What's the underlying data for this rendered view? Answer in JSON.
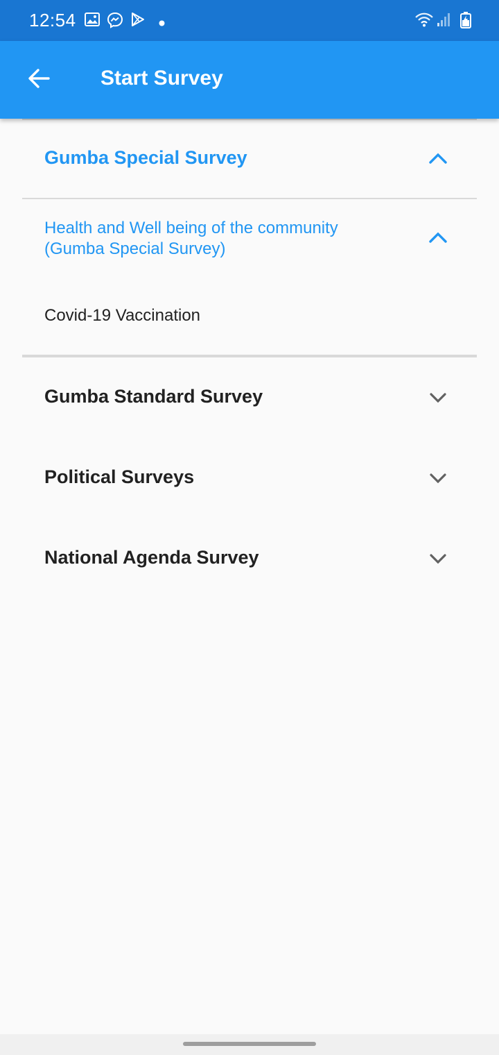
{
  "status_bar": {
    "time": "12:54",
    "left_icons": [
      "image-icon",
      "messenger-icon",
      "play-store-icon",
      "dot-icon"
    ],
    "right_icons": [
      "wifi-icon",
      "signal-icon",
      "battery-icon"
    ]
  },
  "app_bar": {
    "title": "Start Survey",
    "back_icon": "arrow-left-icon"
  },
  "groups": [
    {
      "title": "Gumba Special Survey",
      "expanded": true,
      "subgroups": [
        {
          "title": "Health and Well being of the community",
          "title_line2": "(Gumba Special Survey)",
          "expanded": true,
          "items": [
            "Covid-19 Vaccination"
          ]
        }
      ]
    },
    {
      "title": "Gumba Standard Survey",
      "expanded": false
    },
    {
      "title": "Political Surveys",
      "expanded": false
    },
    {
      "title": "National Agenda Survey",
      "expanded": false
    }
  ],
  "colors": {
    "status_bar": "#1976d2",
    "app_bar": "#2196f3",
    "accent": "#2196f3",
    "text_dark": "#212121",
    "background": "#fafafa"
  }
}
